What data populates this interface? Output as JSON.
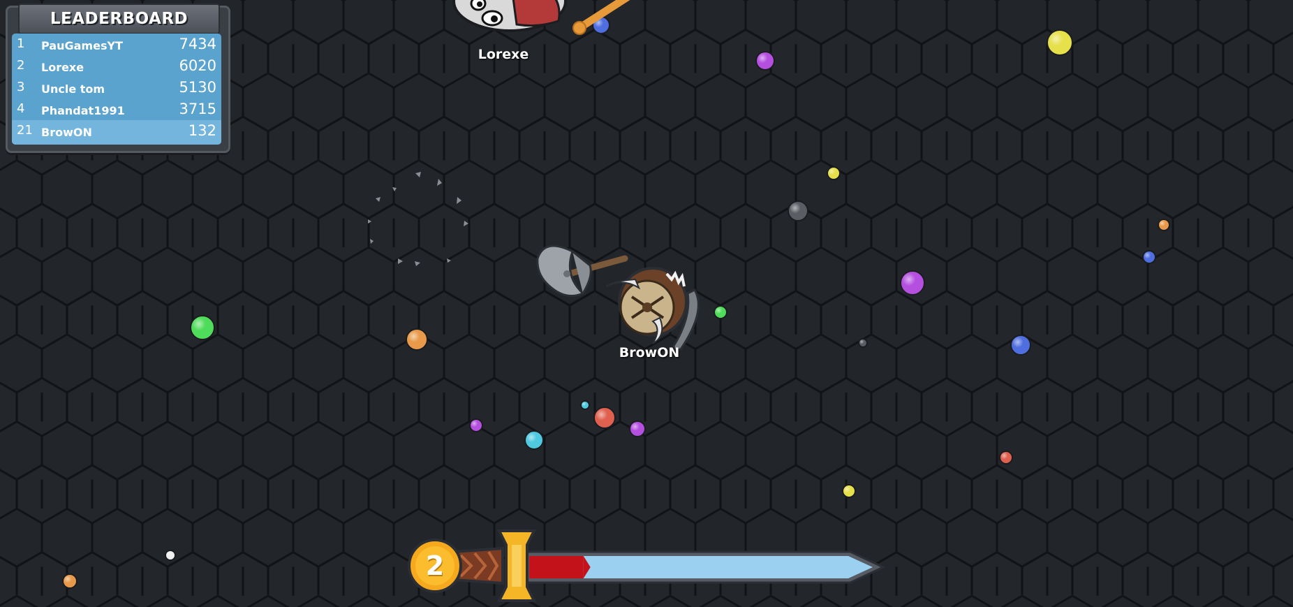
{
  "leaderboard": {
    "title": "LEADERBOARD",
    "rows": [
      {
        "rank": "1",
        "name": "PauGamesYT",
        "score": "7434"
      },
      {
        "rank": "2",
        "name": "Lorexe",
        "score": "6020"
      },
      {
        "rank": "3",
        "name": "Uncle tom",
        "score": "5130"
      },
      {
        "rank": "4",
        "name": "Phandat1991",
        "score": "3715"
      },
      {
        "rank": "21",
        "name": "BrowON",
        "score": "132"
      }
    ]
  },
  "players": {
    "self_name": "BrowON",
    "other_name": "Lorexe"
  },
  "hud": {
    "level": "2",
    "xp_progress": 0.17
  },
  "colors": {
    "background": "#23262b",
    "hex_line": "#111316",
    "leaderboard_row": "#5aa3cf",
    "xp_red": "#c4121b",
    "xp_blue": "#9bd0f0",
    "level_badge": "#f6a91c"
  }
}
